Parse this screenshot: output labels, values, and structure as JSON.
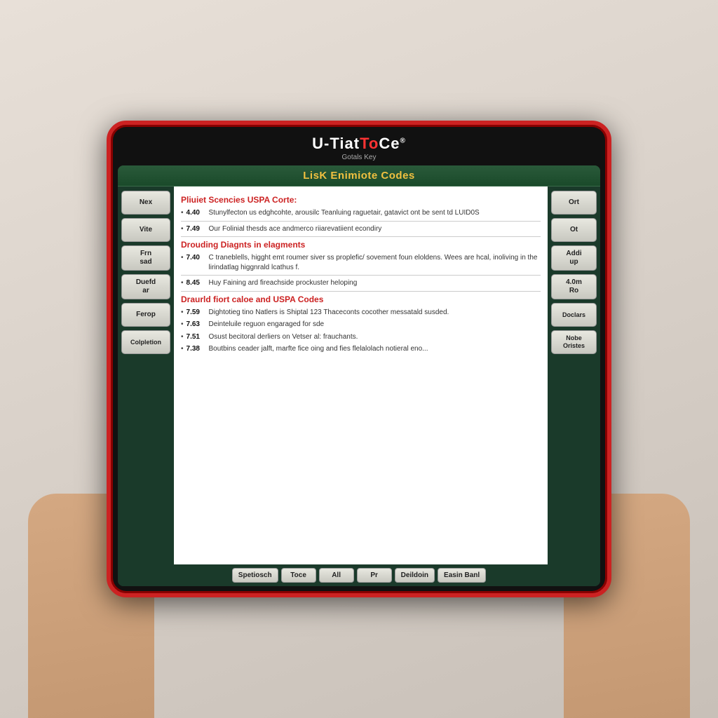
{
  "device": {
    "brand": {
      "prefix": "U-Tiat",
      "highlight": "To",
      "suffix": "Ce",
      "registered": "®",
      "subtitle": "Gotals Key"
    }
  },
  "screen": {
    "title": "LisK Enimiote Codes",
    "sections": [
      {
        "id": "section1",
        "title": "Pliuiet Scencies USPA Corte:",
        "items": [
          {
            "code": "4.40",
            "description": "Stunylfecton us edghcohte, arousilc Teanluing raguetair, gatavict ont be sent td LUID0S"
          },
          {
            "code": "7.49",
            "description": "Our Folinial thesds ace andmerco riiarevatiient econdiry"
          }
        ]
      },
      {
        "id": "section2",
        "title": "Drouding Diagnts in elagments",
        "items": [
          {
            "code": "7.40",
            "description": "C traneblells, higght emt roumer siver ss proplefic/ sovement foun eloldens. Wees are hcal, inoliving in the lirindatlag higgnrald lcathus f."
          },
          {
            "code": "8.45",
            "description": "Huy Faining ard fireachside prockuster heloping"
          }
        ]
      },
      {
        "id": "section3",
        "title": "Draurld fiort caloe and USPA Codes",
        "items": [
          {
            "code": "7.59",
            "description": "Dightotieg tino Natlers is Shiptal 123 Thaceconts cocother messatald susded."
          },
          {
            "code": "7.63",
            "description": "Deinteluile reguon engaraged for sde"
          },
          {
            "code": "7.51",
            "description": "Osust becitoral derliers on Vetser al: frauchants."
          },
          {
            "code": "7.38",
            "description": "Boutbins ceader jalft, marfte fice oing and fies flelalolach notieral eno..."
          }
        ]
      }
    ],
    "left_buttons": [
      {
        "id": "btn-nex",
        "label": "Nex"
      },
      {
        "id": "btn-vite",
        "label": "Vite"
      },
      {
        "id": "btn-frn-sad",
        "label": "Frn\nsad"
      },
      {
        "id": "btn-duefd-ar",
        "label": "Duefd\nar"
      },
      {
        "id": "btn-ferop",
        "label": "Ferop"
      },
      {
        "id": "btn-colpletion",
        "label": "Colpletion"
      }
    ],
    "right_buttons": [
      {
        "id": "btn-ort",
        "label": "Ort"
      },
      {
        "id": "btn-ot",
        "label": "Ot"
      },
      {
        "id": "btn-add-up",
        "label": "Addi\nup"
      },
      {
        "id": "btn-4om-ro",
        "label": "4.0m\nRo"
      },
      {
        "id": "btn-doclars",
        "label": "Doclars"
      },
      {
        "id": "btn-nobe-oristes",
        "label": "Nobe\nOristes"
      }
    ],
    "bottom_buttons": [
      {
        "id": "btn-spetiosch",
        "label": "Spetiosch"
      },
      {
        "id": "btn-toce",
        "label": "Toce"
      },
      {
        "id": "btn-all",
        "label": "All"
      },
      {
        "id": "btn-pr",
        "label": "Pr"
      },
      {
        "id": "btn-deildoin",
        "label": "Deildoin"
      },
      {
        "id": "btn-easin-banl",
        "label": "Easin\nBanl"
      }
    ]
  }
}
